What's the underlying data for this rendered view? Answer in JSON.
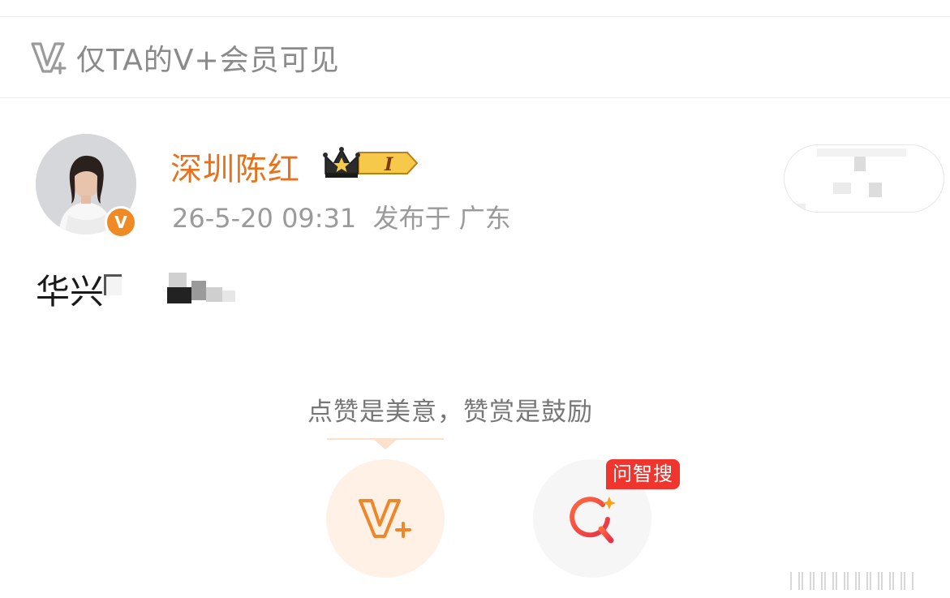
{
  "visibility": {
    "icon": "v-plus-icon",
    "text": "仅TA的V+会员可见"
  },
  "author": {
    "name": "深圳陈红",
    "avatar_icon": "avatar",
    "verified_icon": "verified-v-badge-icon",
    "verified_mark": "V",
    "rank_badge_icon": "crown-rank-badge-icon",
    "rank_badge_text": "I",
    "timestamp": "26-5-20 09:31",
    "location": "发布于 广东"
  },
  "post": {
    "text": "华兴"
  },
  "reward": {
    "prompt": "点赞是美意，赞赏是鼓励",
    "vplus_button_icon": "v-plus-icon",
    "search_button_icon": "ai-search-icon",
    "search_tag": "问智搜"
  },
  "colors": {
    "accent_orange": "#e8721c",
    "tag_red": "#f0342e",
    "muted_text": "#8a8a8a"
  }
}
